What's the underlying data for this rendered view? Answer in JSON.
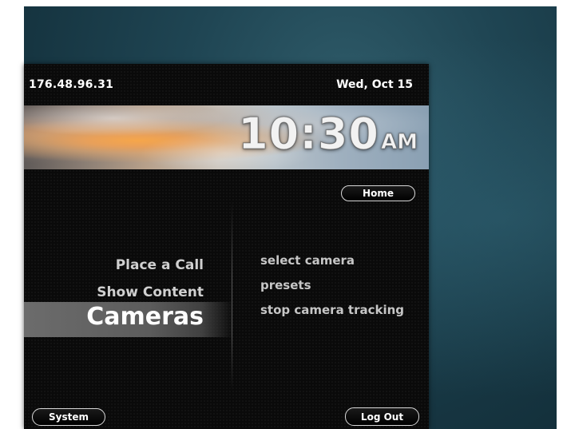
{
  "status_bar": {
    "ip_address": "176.48.96.31",
    "date": "Wed, Oct 15"
  },
  "clock": {
    "time": "10:30",
    "ampm": "AM"
  },
  "buttons": {
    "home_label": "Home",
    "system_label": "System",
    "logout_label": "Log Out"
  },
  "main_menu": {
    "items": [
      {
        "label": "Place a Call",
        "selected": false
      },
      {
        "label": "Show Content",
        "selected": false
      },
      {
        "label": "Cameras",
        "selected": true
      }
    ]
  },
  "submenu": {
    "items": [
      {
        "label": "select camera"
      },
      {
        "label": "presets"
      },
      {
        "label": "stop camera tracking"
      }
    ]
  },
  "colors": {
    "background": "#1f4553",
    "panel": "#0a0a0a",
    "selected_bar": "#5c5c5c",
    "text": "#ffffff"
  }
}
